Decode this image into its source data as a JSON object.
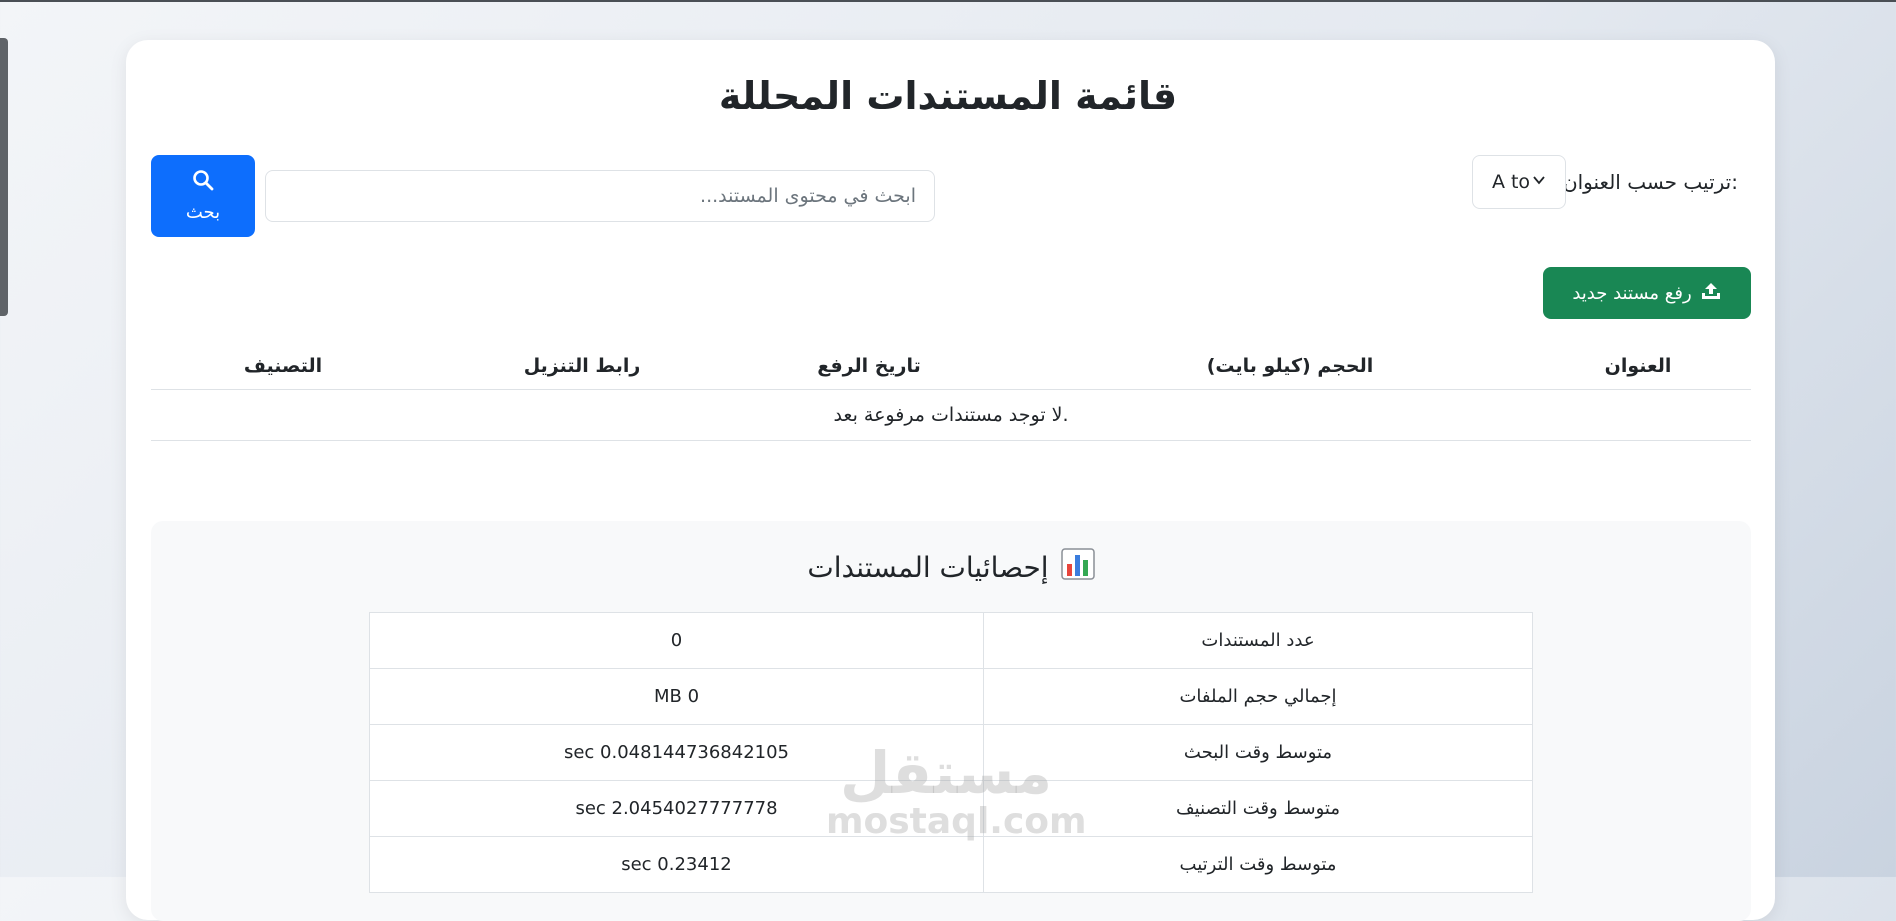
{
  "page": {
    "title": "قائمة المستندات المحللة"
  },
  "toolbar": {
    "sort_label": "ترتيب حسب العنوان:",
    "sort_value": "A to",
    "search_placeholder": "ابحث في محتوى المستند...",
    "search_value": "",
    "search_button_label": "بحث",
    "search_icon": "search-icon"
  },
  "upload": {
    "label": "رفع مستند جديد",
    "icon": "upload-icon"
  },
  "documents_table": {
    "headers": [
      "العنوان",
      "الحجم (كيلو بايت)",
      "تاريخ الرفع",
      "رابط التنزيل",
      "التصنيف"
    ],
    "empty_message": "لا توجد مستندات مرفوعة بعد."
  },
  "statistics": {
    "title": "إحصائيات المستندات",
    "icon": "bar-chart-icon",
    "rows": [
      {
        "label": "عدد المستندات",
        "value": "0"
      },
      {
        "label": "إجمالي حجم الملفات",
        "value": "MB 0"
      },
      {
        "label": "متوسط وقت البحث",
        "value": "sec 0.048144736842105"
      },
      {
        "label": "متوسط وقت التصنيف",
        "value": "sec 2.0454027777778"
      },
      {
        "label": "متوسط وقت الترتيب",
        "value": "sec 0.23412"
      }
    ]
  },
  "watermark": {
    "arabic": "مستقل",
    "latin": "mostaql.com"
  },
  "colors": {
    "primary": "#0d6efd",
    "success": "#198754",
    "border": "#dee2e6",
    "panel": "#f8f9fa"
  }
}
